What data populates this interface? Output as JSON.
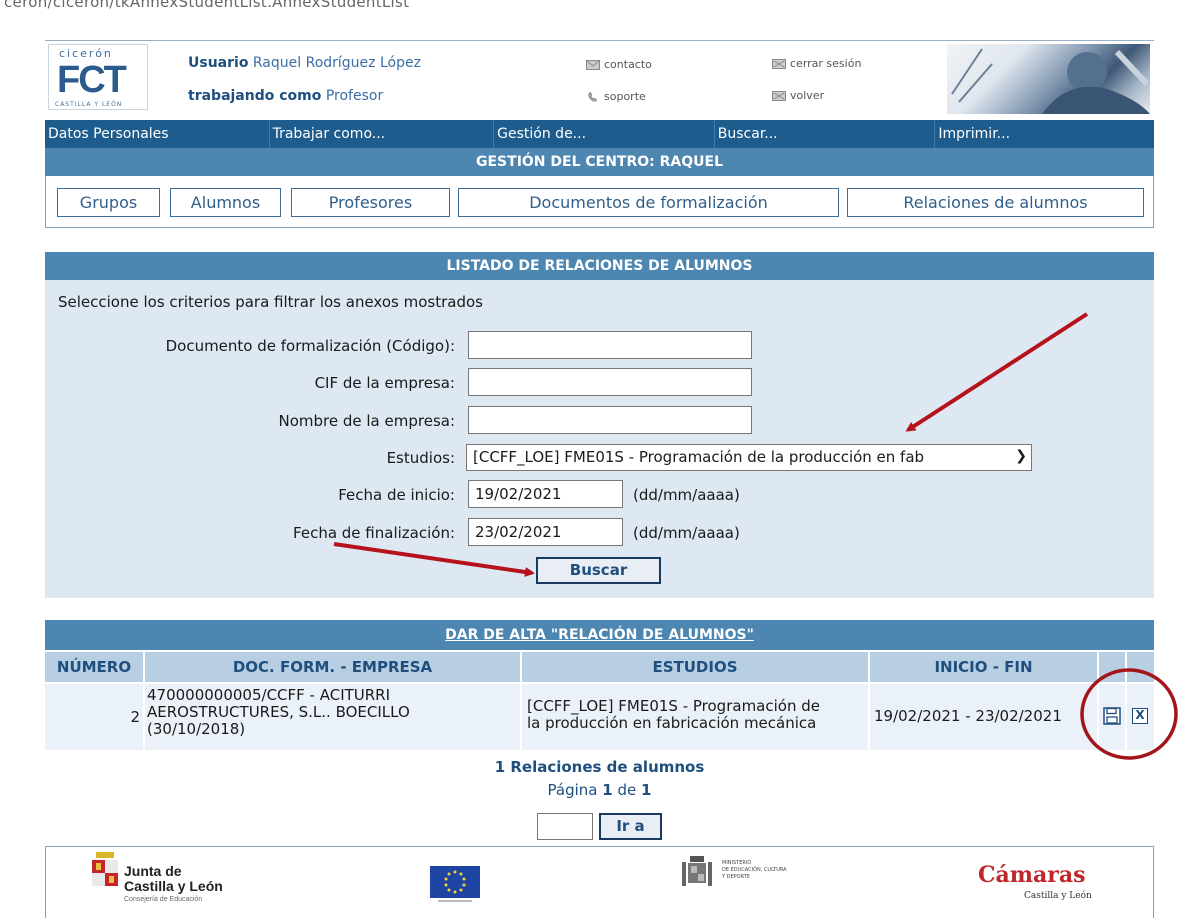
{
  "address_bar": "ceron/ciceron/tkAnnexStudentList.AnnexStudentList",
  "logo": {
    "top": "cicerón",
    "main": "FCT",
    "bottom": "CASTILLA Y LEÓN"
  },
  "header": {
    "user_label": "Usuario",
    "user_name": "Raquel Rodríguez López",
    "role_label": "trabajando como",
    "role_name": "Profesor",
    "links": {
      "contacto": "contacto",
      "soporte": "soporte",
      "cerrar": "cerrar sesión",
      "volver": "volver"
    }
  },
  "nav": [
    "Datos Personales",
    "Trabajar como...",
    "Gestión de...",
    "Buscar...",
    "Imprimir..."
  ],
  "center_title": "GESTIÓN DEL CENTRO: RAQUEL",
  "tabs": [
    "Grupos",
    "Alumnos",
    "Profesores",
    "Documentos de formalización",
    "Relaciones de alumnos"
  ],
  "filter": {
    "title": "LISTADO DE RELACIONES DE ALUMNOS",
    "intro": "Seleccione los criterios para filtrar los anexos mostrados",
    "labels": {
      "doc": "Documento de formalización (Código):",
      "cif": "CIF de la empresa:",
      "nombre": "Nombre de la empresa:",
      "estudios": "Estudios:",
      "inicio": "Fecha de inicio:",
      "fin": "Fecha de finalización:"
    },
    "values": {
      "doc": "",
      "cif": "",
      "nombre": "",
      "estudios": "[CCFF_LOE] FME01S - Programación de la producción en fab",
      "inicio": "19/02/2021",
      "fin": "23/02/2021"
    },
    "date_hint": "(dd/mm/aaaa)",
    "search_button": "Buscar"
  },
  "results": {
    "title": "DAR DE ALTA \"RELACIÓN DE ALUMNOS\"",
    "columns": [
      "NÚMERO",
      "DOC. FORM. - EMPRESA",
      "ESTUDIOS",
      "INICIO - FIN"
    ],
    "rows": [
      {
        "numero": "2",
        "doc_line1": "470000000005/CCFF - ACITURRI",
        "doc_line2": "AEROSTRUCTURES, S.L.. BOECILLO",
        "doc_line3": "(30/10/2018)",
        "estudios_line1": "[CCFF_LOE] FME01S - Programación de",
        "estudios_line2": "la producción en fabricación mecánica",
        "fechas": "19/02/2021 - 23/02/2021"
      }
    ],
    "summary": "1 Relaciones de alumnos",
    "page_prefix": "Página",
    "page_current": "1",
    "page_sep": "de",
    "page_total": "1",
    "goto_button": "Ir a",
    "delete_glyph": "X"
  },
  "footer": {
    "jcyl_line1": "Junta de",
    "jcyl_line2": "Castilla y León",
    "jcyl_line3": "Consejería de Educación",
    "ministerio_line1": "MINISTERIO",
    "ministerio_line2": "DE EDUCACIÓN, CULTURA",
    "ministerio_line3": "Y DEPORTE",
    "camaras_line1": "Cámaras",
    "camaras_line2": "Castilla y León"
  },
  "colors": {
    "nav": "#1d5c8c",
    "band": "#4d86b0",
    "panel": "#dde8f3",
    "annotation": "#b5121b"
  }
}
